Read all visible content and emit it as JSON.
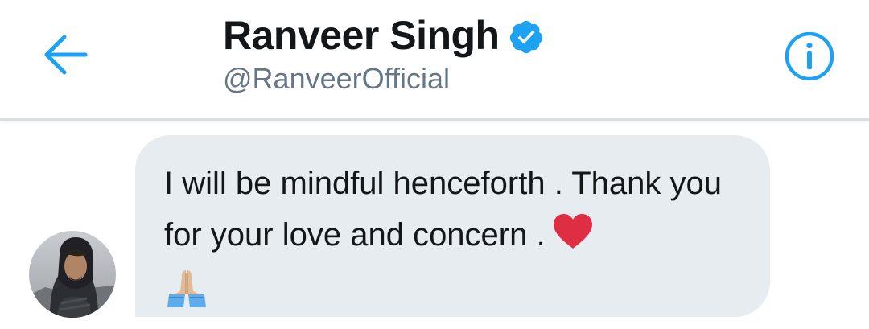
{
  "header": {
    "title": "Ranveer Singh",
    "handle": "@RanveerOfficial",
    "verified": true,
    "back_icon": "arrow-left-icon",
    "info_icon": "info-icon"
  },
  "conversation": {
    "messages": [
      {
        "sender": "Ranveer Singh",
        "text": "I will be mindful henceforth . Thank you for your love and concern .",
        "emoji": [
          "red-heart",
          "folded-hands"
        ]
      }
    ]
  },
  "colors": {
    "accent": "#1da1f2",
    "title": "#14171a",
    "handle": "#657786",
    "bubble": "#e6ecf0",
    "heart": "#dd2e44"
  }
}
